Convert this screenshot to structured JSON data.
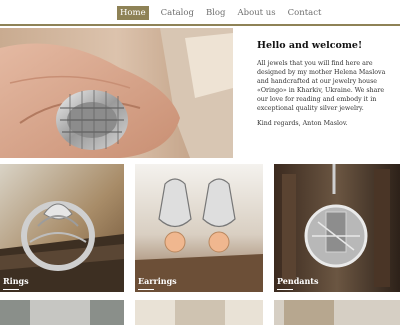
{
  "nav": {
    "items": [
      "Home",
      "Catalog",
      "Blog",
      "About us",
      "Contact"
    ]
  },
  "welcome": {
    "title": "Hello and welcome!",
    "body": "All jewels that you will find here are designed by my mother Helena Maslova and handcrafted at our jewelry house «Oringo» in Kharkiv, Ukraine. We share our love for reading and embody it in exceptional quality silver jewelry.",
    "signature": "Kind regards, Anton Maslov."
  },
  "categories": [
    {
      "label": "Rings"
    },
    {
      "label": "Earrings"
    },
    {
      "label": "Pendants"
    }
  ],
  "colors": {
    "accent": "#8e8256"
  }
}
